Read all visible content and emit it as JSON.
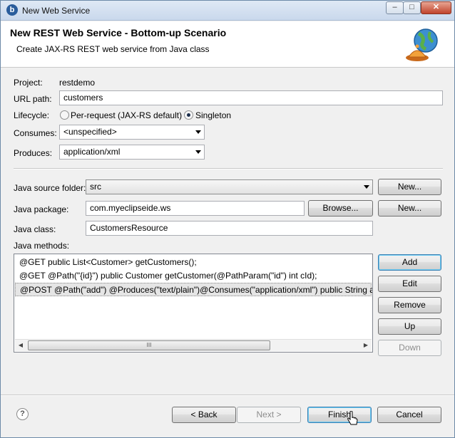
{
  "window": {
    "title": "New Web Service",
    "controls": {
      "minimize": "–",
      "maximize": "□",
      "close": "✕"
    }
  },
  "banner": {
    "title": "New REST Web Service - Bottom-up Scenario",
    "subtitle": "Create JAX-RS REST web service from Java class",
    "icon": "globe-bell-icon"
  },
  "form": {
    "project_label": "Project:",
    "project_value": "restdemo",
    "url_label": "URL path:",
    "url_value": "customers",
    "lifecycle_label": "Lifecycle:",
    "lifecycle_options": [
      {
        "label": "Per-request (JAX-RS default)",
        "selected": false
      },
      {
        "label": "Singleton",
        "selected": true
      }
    ],
    "consumes_label": "Consumes:",
    "consumes_value": "<unspecified>",
    "produces_label": "Produces:",
    "produces_value": "application/xml",
    "source_folder_label": "Java source folder:",
    "source_folder_value": "src",
    "package_label": "Java package:",
    "package_value": "com.myeclipseide.ws",
    "class_label": "Java class:",
    "class_value": "CustomersResource",
    "methods_label": "Java methods:",
    "methods": [
      "@GET  public List<Customer> getCustomers();",
      "@GET @Path(\"{id}\") public Customer getCustomer(@PathParam(\"id\") int cId);",
      "@POST @Path(\"add\") @Produces(\"text/plain\")@Consumes(\"application/xml\") public String a"
    ],
    "selected_method_index": 2
  },
  "buttons": {
    "new_folder": "New...",
    "browse": "Browse...",
    "new_package": "New...",
    "add": "Add",
    "edit": "Edit",
    "remove": "Remove",
    "up": "Up",
    "down": "Down",
    "back": "< Back",
    "next": "Next >",
    "finish": "Finish",
    "cancel": "Cancel"
  },
  "scrollbar_grip": "III",
  "help_glyph": "?"
}
